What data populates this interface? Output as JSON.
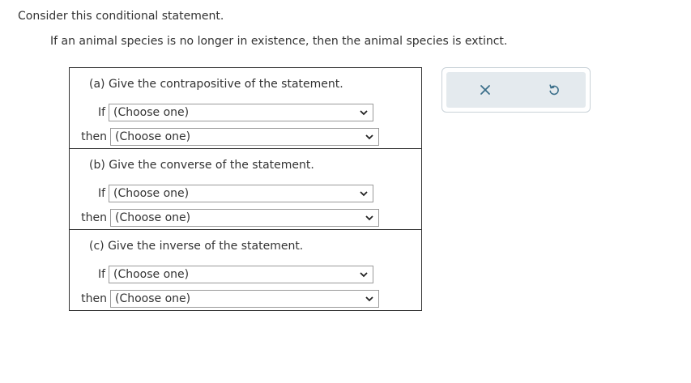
{
  "intro": "Consider this conditional statement.",
  "statement": "If an animal species is no longer in existence, then the animal species is extinct.",
  "parts": [
    {
      "title": "(a) Give the contrapositive of the statement.",
      "if_label": "If",
      "if_value": "(Choose one)",
      "then_label": "then",
      "then_value": "(Choose one)"
    },
    {
      "title": "(b) Give the converse of the statement.",
      "if_label": "If",
      "if_value": "(Choose one)",
      "then_label": "then",
      "then_value": "(Choose one)"
    },
    {
      "title": "(c) Give the inverse of the statement.",
      "if_label": "If",
      "if_value": "(Choose one)",
      "then_label": "then",
      "then_value": "(Choose one)"
    }
  ],
  "tools": {
    "clear_icon": "close-icon",
    "undo_icon": "undo-icon",
    "icon_color": "#3b6f8a"
  }
}
